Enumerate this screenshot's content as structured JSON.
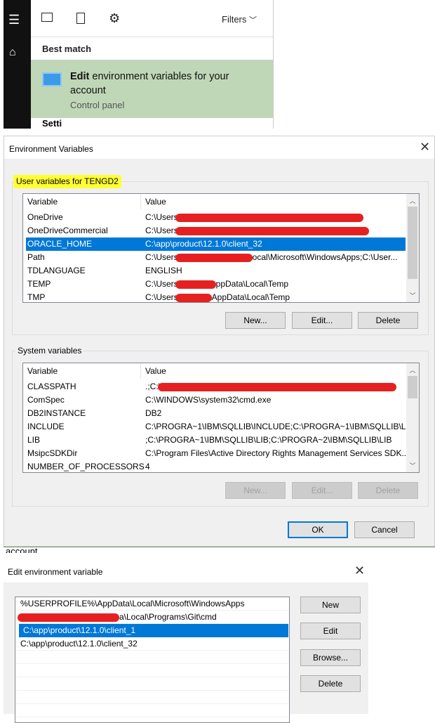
{
  "search": {
    "filters_label": "Filters",
    "best_match_label": "Best match",
    "result": {
      "title_bold": "Edit",
      "title_rest": " environment variables for your account",
      "subtitle": "Control panel"
    },
    "next_section_partial": "Setti",
    "highlight_color": "#bfd7b7"
  },
  "env_dialog": {
    "title": "Environment Variables",
    "user_group_label": "User variables for TENGD2",
    "columns": [
      "Variable",
      "Value"
    ],
    "user_vars": [
      {
        "name": "OneDrive",
        "prefix": "C:\\Users",
        "suffix": ""
      },
      {
        "name": "OneDriveCommercial",
        "prefix": "C:\\Users",
        "suffix": ""
      },
      {
        "name": "ORACLE_HOME",
        "prefix": "C:\\app\\product\\12.1.0\\client_32",
        "suffix": ""
      },
      {
        "name": "Path",
        "prefix": "C:\\Users",
        "suffix": "ocal\\Microsoft\\WindowsApps;C:\\User..."
      },
      {
        "name": "TDLANGUAGE",
        "prefix": "ENGLISH",
        "suffix": ""
      },
      {
        "name": "TEMP",
        "prefix": "C:\\Users",
        "suffix": "ppData\\Local\\Temp"
      },
      {
        "name": "TMP",
        "prefix": "C:\\Users",
        "suffix": "AppData\\Local\\Temp"
      }
    ],
    "user_buttons": {
      "new": "New...",
      "edit": "Edit...",
      "delete": "Delete"
    },
    "system_group_label": "System variables",
    "system_vars": [
      {
        "name": "CLASSPATH",
        "prefix": ".;C:\\",
        "suffix": ""
      },
      {
        "name": "ComSpec",
        "prefix": "C:\\WINDOWS\\system32\\cmd.exe",
        "suffix": ""
      },
      {
        "name": "DB2INSTANCE",
        "prefix": "DB2",
        "suffix": ""
      },
      {
        "name": "INCLUDE",
        "prefix": "C:\\PROGRA~1\\IBM\\SQLLIB\\INCLUDE;C:\\PROGRA~1\\IBM\\SQLLIB\\L...",
        "suffix": ""
      },
      {
        "name": "LIB",
        "prefix": ";C:\\PROGRA~1\\IBM\\SQLLIB\\LIB;C:\\PROGRA~2\\IBM\\SQLLIB\\LIB",
        "suffix": ""
      },
      {
        "name": "MsipcSDKDir",
        "prefix": "C:\\Program Files\\Active Directory Rights Management Services SDK...",
        "suffix": ""
      },
      {
        "name": "NUMBER_OF_PROCESSORS",
        "prefix": "4",
        "suffix": ""
      }
    ],
    "system_buttons": {
      "new": "New...",
      "edit": "Edit...",
      "delete": "Delete"
    },
    "ok": "OK",
    "cancel": "Cancel",
    "selected_user_var": "ORACLE_HOME"
  },
  "behind_text": "account",
  "edit_dialog": {
    "title": "Edit environment variable",
    "entries": [
      {
        "prefix": "%USERPROFILE%\\AppData\\Local\\Microsoft\\WindowsApps",
        "redacted": false
      },
      {
        "prefix": "a\\Local\\Programs\\Git\\cmd",
        "redacted": true
      },
      {
        "prefix": "C:\\app\\product\\12.1.0\\client_1",
        "redacted": false
      },
      {
        "prefix": "C:\\app\\product\\12.1.0\\client_32",
        "redacted": false
      }
    ],
    "selected_entry": "C:\\app\\product\\12.1.0\\client_1",
    "buttons": {
      "new": "New",
      "edit": "Edit",
      "browse": "Browse...",
      "delete": "Delete"
    }
  },
  "colors": {
    "selection": "#0078d7",
    "redaction": "#e62020",
    "annotation_highlight": "#ffff33"
  }
}
